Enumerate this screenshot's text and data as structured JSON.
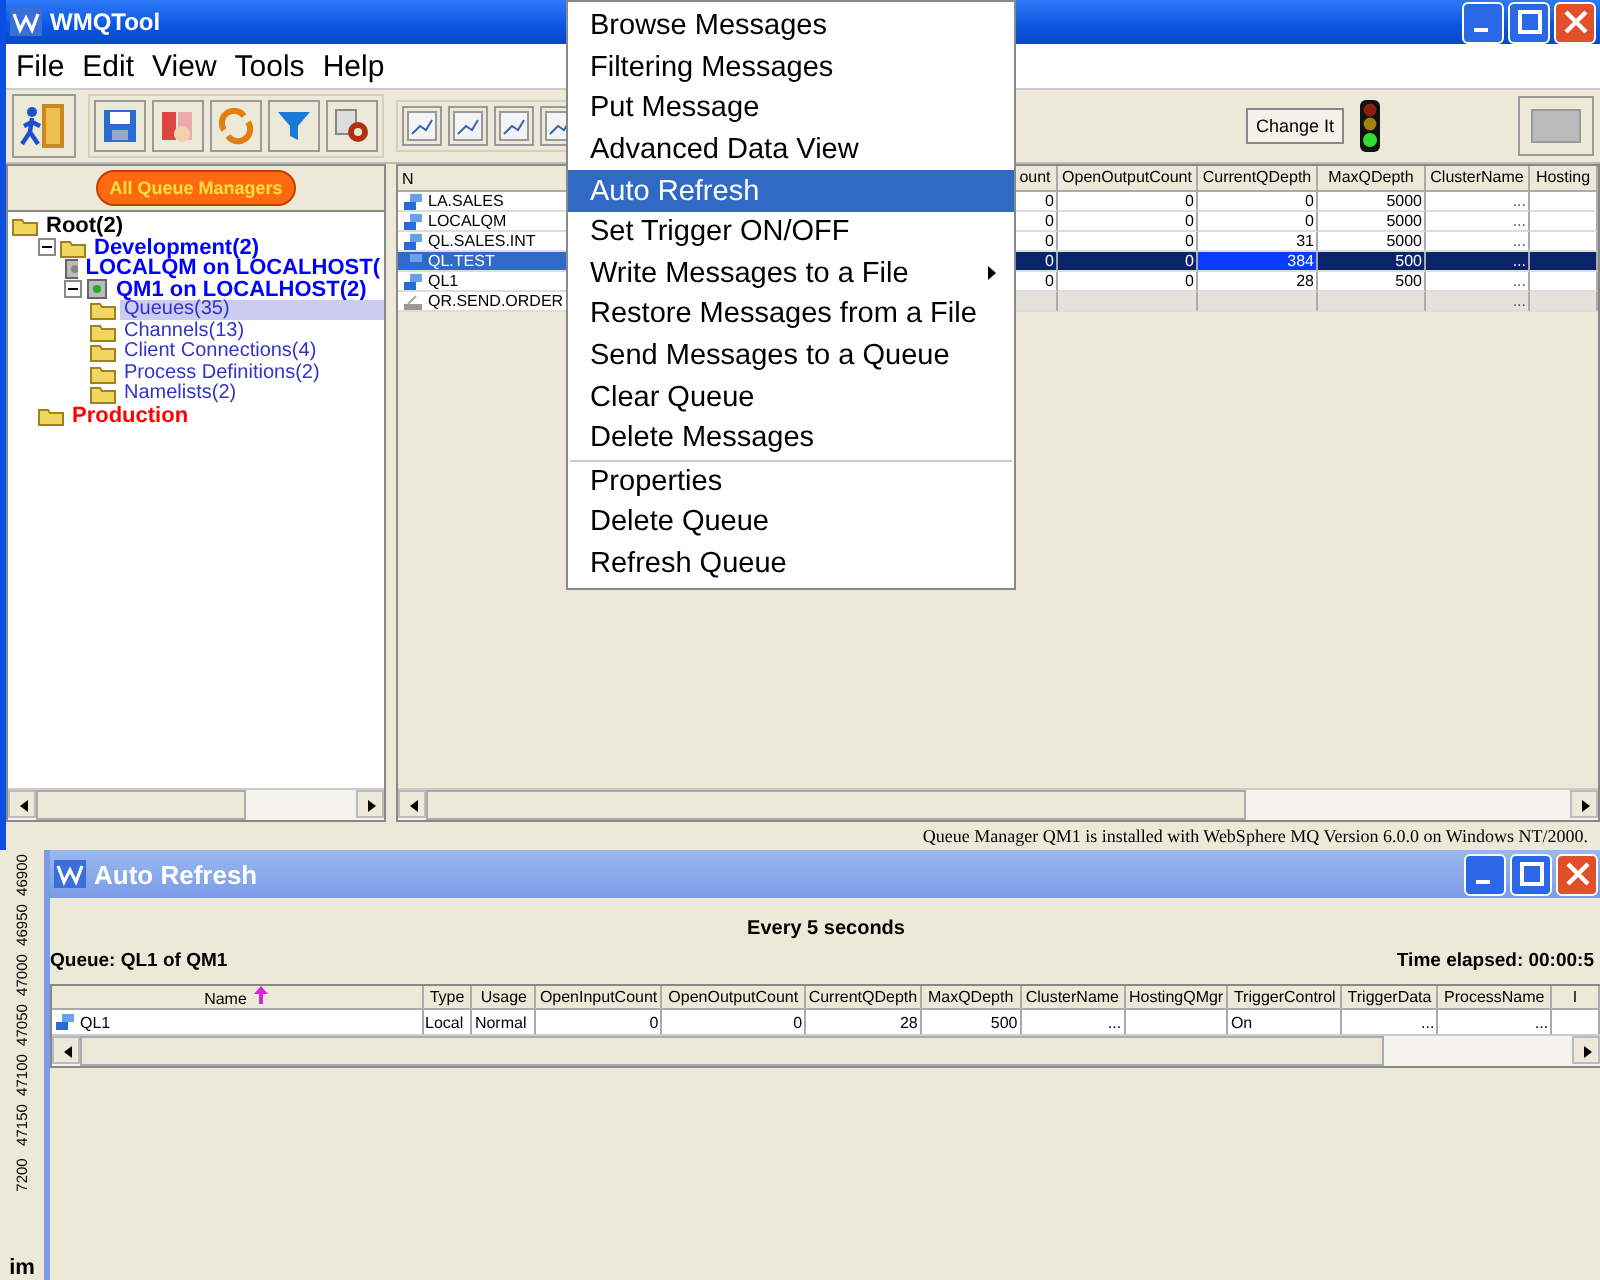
{
  "window": {
    "title": "WMQTool"
  },
  "menu_bar": [
    "File",
    "Edit",
    "View",
    "Tools",
    "Help"
  ],
  "toolbar": {
    "change_button": "Change It"
  },
  "tree_button": "All Queue Managers",
  "tree": [
    {
      "label": "Root(2)",
      "kind": "root",
      "color": "#000000",
      "selected": false,
      "children": [
        {
          "label": "Development(2)",
          "kind": "group",
          "color": "#0000ff",
          "expanded": true,
          "selected": false,
          "children": [
            {
              "label": "LOCALQM on LOCALHOST(",
              "kind": "qmgr",
              "color": "#0000ff",
              "selected": false
            },
            {
              "label": "QM1 on LOCALHOST(2)",
              "kind": "qmgr",
              "color": "#0000ff",
              "expanded": true,
              "selected": false,
              "children": [
                {
                  "label": "Queues(35)",
                  "kind": "folder",
                  "color": "#3333cc",
                  "selected": true
                },
                {
                  "label": "Channels(13)",
                  "kind": "folder",
                  "color": "#3333cc",
                  "selected": false
                },
                {
                  "label": "Client Connections(4)",
                  "kind": "folder",
                  "color": "#3333cc",
                  "selected": false
                },
                {
                  "label": "Process Definitions(2)",
                  "kind": "folder",
                  "color": "#3333cc",
                  "selected": false
                },
                {
                  "label": "Namelists(2)",
                  "kind": "folder",
                  "color": "#3333cc",
                  "selected": false
                }
              ]
            }
          ]
        },
        {
          "label": "Production",
          "kind": "group",
          "color": "#ff0000",
          "selected": false
        }
      ]
    }
  ],
  "queue_table": {
    "columns": [
      "N",
      "ount",
      "OpenOutputCount",
      "CurrentQDepth",
      "MaxQDepth",
      "ClusterName",
      "Hosting"
    ],
    "rows": [
      {
        "kind": "local",
        "cells": [
          "LA.SALES",
          "0",
          "0",
          "0",
          "5000",
          "...",
          null
        ],
        "selected": false
      },
      {
        "kind": "local",
        "cells": [
          "LOCALQM",
          "0",
          "0",
          "0",
          "5000",
          "...",
          null
        ],
        "selected": false
      },
      {
        "kind": "local",
        "cells": [
          "QL.SALES.INT",
          "0",
          "0",
          "31",
          "5000",
          "...",
          null
        ],
        "selected": false
      },
      {
        "kind": "local",
        "cells": [
          "QL.TEST",
          "0",
          "0",
          "384",
          "500",
          "...",
          null
        ],
        "selected": true
      },
      {
        "kind": "local",
        "cells": [
          "QL1",
          "0",
          "0",
          "28",
          "500",
          "...",
          null
        ],
        "selected": false
      },
      {
        "kind": "remote",
        "cells": [
          "QR.SEND.ORDER",
          null,
          null,
          null,
          null,
          "...",
          null
        ],
        "selected": false
      }
    ]
  },
  "context_menu": {
    "groups": [
      [
        {
          "label": "Browse Messages",
          "selected": false,
          "submenu": false
        },
        {
          "label": "Filtering Messages",
          "selected": false,
          "submenu": false
        },
        {
          "label": "Put Message",
          "selected": false,
          "submenu": false
        },
        {
          "label": "Advanced Data View",
          "selected": false,
          "submenu": false
        },
        {
          "label": "Auto Refresh",
          "selected": true,
          "submenu": false
        },
        {
          "label": "Set Trigger ON/OFF",
          "selected": false,
          "submenu": false
        },
        {
          "label": "Write Messages to a File",
          "selected": false,
          "submenu": true
        },
        {
          "label": "Restore Messages from a File",
          "selected": false,
          "submenu": false
        },
        {
          "label": "Send Messages to a Queue",
          "selected": false,
          "submenu": false
        },
        {
          "label": "Clear Queue",
          "selected": false,
          "submenu": false
        },
        {
          "label": "Delete Messages",
          "selected": false,
          "submenu": false
        }
      ],
      [
        {
          "label": "Properties",
          "selected": false,
          "submenu": false
        },
        {
          "label": "Delete Queue",
          "selected": false,
          "submenu": false
        },
        {
          "label": "Refresh Queue",
          "selected": false,
          "submenu": false
        }
      ]
    ]
  },
  "status_bar": "Queue Manager QM1 is installed with WebSphere MQ Version 6.0.0 on Windows NT/2000.",
  "left_ruler": {
    "labels": [
      "46900",
      "46950",
      "47000",
      "47050",
      "47100",
      "47150",
      "7200"
    ],
    "caption": "im"
  },
  "auto_refresh_window": {
    "title": "Auto Refresh",
    "interval": "Every 5 seconds",
    "queue": "Queue: QL1 of QM1",
    "elapsed": "Time elapsed: 00:00:5",
    "columns": [
      "Name",
      "Type",
      "Usage",
      "OpenInputCount",
      "OpenOutputCount",
      "CurrentQDepth",
      "MaxQDepth",
      "ClusterName",
      "HostingQMgr",
      "TriggerControl",
      "TriggerData",
      "ProcessName",
      "I"
    ],
    "rows": [
      [
        "QL1",
        "Local",
        "Normal",
        "0",
        "0",
        "28",
        "500",
        "...",
        null,
        "On",
        "...",
        "...",
        null
      ]
    ]
  }
}
